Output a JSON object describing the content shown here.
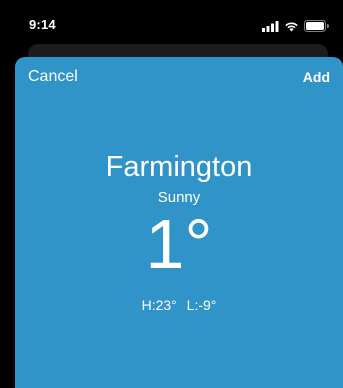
{
  "status_bar": {
    "time": "9:14",
    "icons": [
      "signal-icon",
      "wifi-icon",
      "battery-icon"
    ]
  },
  "header": {
    "cancel_label": "Cancel",
    "add_label": "Add"
  },
  "weather": {
    "city": "Farmington",
    "condition": "Sunny",
    "temperature": "1°",
    "high": "H:23°",
    "low": "L:-9°"
  },
  "colors": {
    "sheet_background": "#3194c8",
    "status_bar_background": "#000000",
    "text": "#ffffff"
  }
}
